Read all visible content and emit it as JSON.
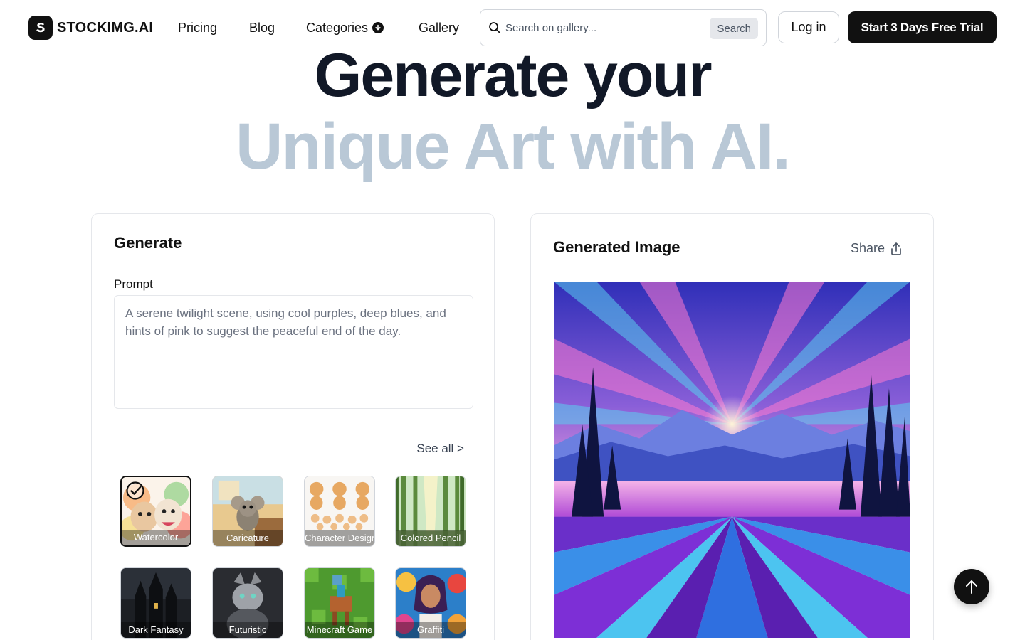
{
  "brand": {
    "name": "STOCKIMG.AI",
    "icon": "stockimg-logo-icon"
  },
  "nav": {
    "pricing": "Pricing",
    "blog": "Blog",
    "categories": "Categories",
    "gallery": "Gallery"
  },
  "search": {
    "placeholder": "Search on gallery...",
    "button": "Search"
  },
  "auth": {
    "login": "Log in",
    "trial": "Start 3 Days Free Trial"
  },
  "hero": {
    "line1": "Generate your",
    "line2": "Unique Art with AI."
  },
  "generate": {
    "title": "Generate",
    "prompt_label": "Prompt",
    "prompt_value": "A serene twilight scene, using cool purples, deep blues, and hints of pink to suggest the peaceful end of the day.",
    "see_all": "See all >",
    "styles": [
      {
        "label": "Watercolor",
        "selected": true
      },
      {
        "label": "Caricature",
        "selected": false
      },
      {
        "label": "Character Design",
        "selected": false
      },
      {
        "label": "Colored Pencil",
        "selected": false
      },
      {
        "label": "Dark Fantasy",
        "selected": false
      },
      {
        "label": "Futuristic",
        "selected": false
      },
      {
        "label": "Minecraft Game",
        "selected": false
      },
      {
        "label": "Graffiti",
        "selected": false
      }
    ]
  },
  "result": {
    "title": "Generated Image",
    "share": "Share"
  },
  "colors": {
    "accent": "#111111",
    "hero_muted": "#b9c8d6",
    "border": "#e5e7eb"
  }
}
